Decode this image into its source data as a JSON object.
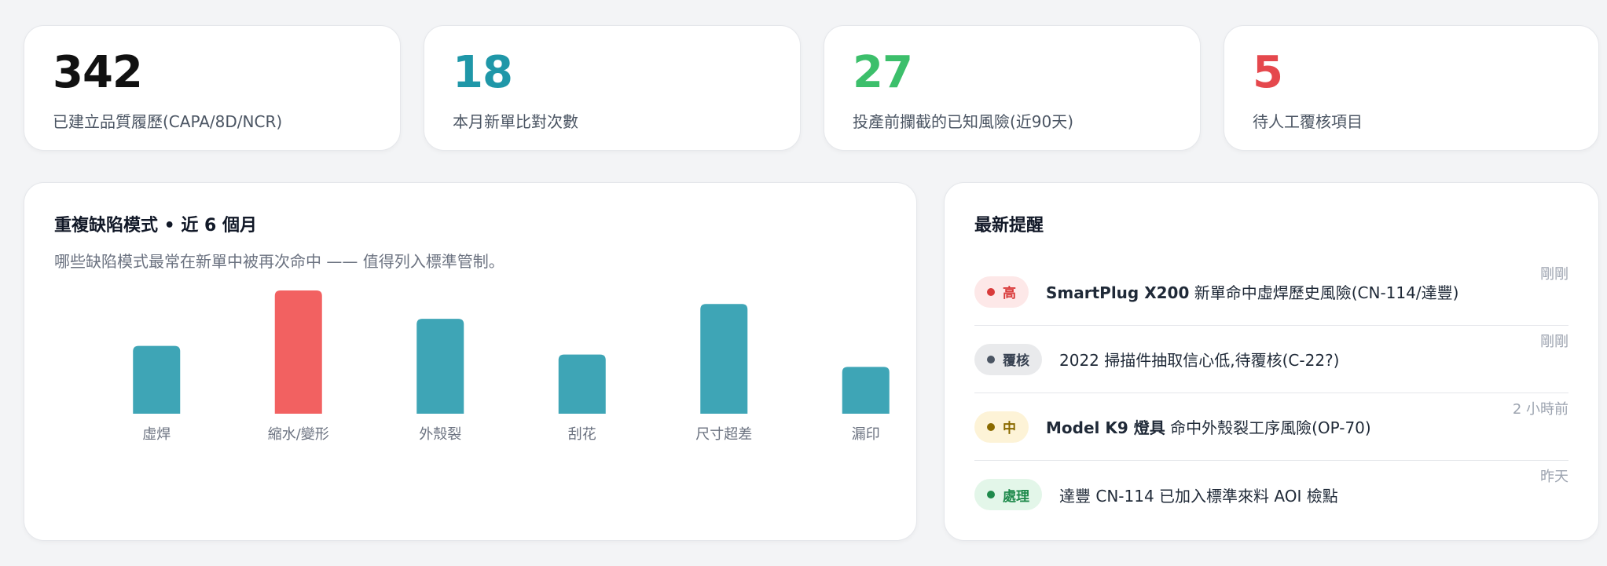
{
  "stats": [
    {
      "value": "342",
      "label": "已建立品質履歷(CAPA/8D/NCR)",
      "color": "#111111"
    },
    {
      "value": "18",
      "label": "本月新單比對次數",
      "color": "#1f97a8"
    },
    {
      "value": "27",
      "label": "投產前攔截的已知風險(近90天)",
      "color": "#3cbf6b"
    },
    {
      "value": "5",
      "label": "待人工覆核項目",
      "color": "#e5484d"
    }
  ],
  "chart_panel": {
    "title": "重複缺陷模式 • 近 6 個月",
    "subtitle": "哪些缺陷模式最常在新單中被再次命中 —— 值得列入標準管制。"
  },
  "chart_data": {
    "type": "bar",
    "categories": [
      "虛焊",
      "縮水/變形",
      "外殼裂",
      "刮花",
      "尺寸超差",
      "漏印"
    ],
    "values": [
      55,
      100,
      77,
      48,
      89,
      38
    ],
    "highlight_index": 1,
    "colors": {
      "default": "#3ea5b6",
      "highlight": "#f26161"
    },
    "ylim": [
      0,
      100
    ],
    "grid": false
  },
  "alerts_panel": {
    "title": "最新提醒",
    "items": [
      {
        "badge": "高",
        "badge_bg": "#fde8e8",
        "badge_fg": "#d93a3a",
        "dot": "#d93a3a",
        "bold": "SmartPlug X200",
        "text": " 新單命中虛焊歷史風險(CN-114/達豐)",
        "time": "剛剛"
      },
      {
        "badge": "覆核",
        "badge_bg": "#e9eaec",
        "badge_fg": "#374151",
        "dot": "#4b5563",
        "bold": "",
        "text": "2022 掃描件抽取信心低,待覆核(C-22?)",
        "time": "剛剛"
      },
      {
        "badge": "中",
        "badge_bg": "#fdf3d7",
        "badge_fg": "#8a6a00",
        "dot": "#8a6a00",
        "bold": "Model K9 燈具",
        "text": " 命中外殼裂工序風險(OP-70)",
        "time": "2 小時前"
      },
      {
        "badge": "處理",
        "badge_bg": "#e3f6e9",
        "badge_fg": "#1f8a4c",
        "dot": "#1f8a4c",
        "bold": "",
        "text": "達豐 CN-114 已加入標準來料 AOI 檢點",
        "time": "昨天"
      }
    ]
  }
}
